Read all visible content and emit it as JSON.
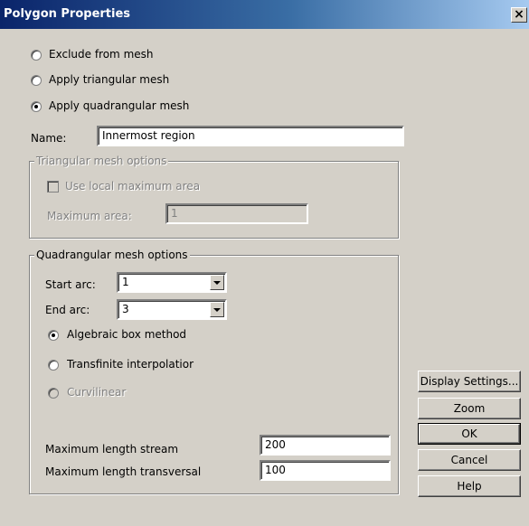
{
  "window": {
    "title": "Polygon Properties",
    "close_glyph": "×"
  },
  "mesh_mode": {
    "options": [
      {
        "label": "Exclude from mesh",
        "checked": false
      },
      {
        "label": "Apply triangular mesh",
        "checked": false
      },
      {
        "label": "Apply quadrangular mesh",
        "checked": true
      }
    ]
  },
  "name": {
    "label": "Name:",
    "value": "Innermost region"
  },
  "triangular": {
    "title": "Triangular mesh options",
    "use_local_label": "Use local maximum area",
    "max_area_label": "Maximum area:",
    "max_area_value": "1",
    "enabled": false
  },
  "quadrangular": {
    "title": "Quadrangular mesh options",
    "start_arc_label": "Start arc:",
    "start_arc_value": "1",
    "end_arc_label": "End arc:",
    "end_arc_value": "3",
    "methods": [
      {
        "label": "Algebraic box method",
        "checked": true,
        "enabled": true
      },
      {
        "label": "Transfinite interpolatior",
        "checked": false,
        "enabled": true
      },
      {
        "label": "Curvilinear",
        "checked": false,
        "enabled": false
      }
    ],
    "max_stream_label": "Maximum length stream",
    "max_stream_value": "200",
    "max_transversal_label": "Maximum length transversal",
    "max_transversal_value": "100"
  },
  "buttons": {
    "display_settings": "Display Settings...",
    "zoom": "Zoom",
    "ok": "OK",
    "cancel": "Cancel",
    "help": "Help"
  }
}
